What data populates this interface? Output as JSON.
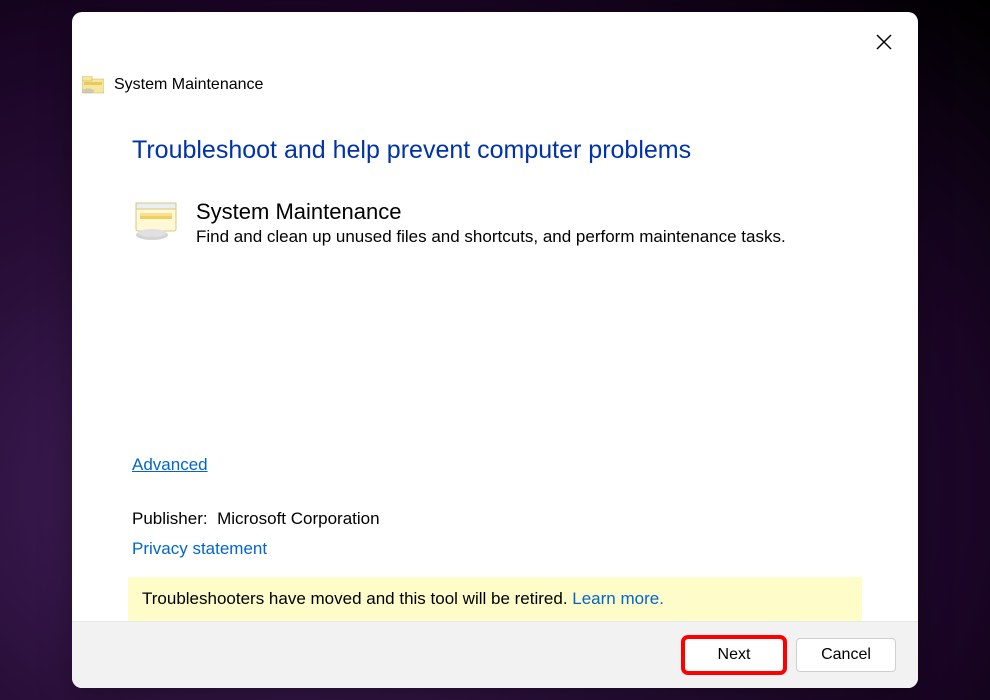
{
  "header": {
    "title": "System Maintenance"
  },
  "main": {
    "heading": "Troubleshoot and help prevent computer problems",
    "item_title": "System Maintenance",
    "item_desc": "Find and clean up unused files and shortcuts, and perform maintenance tasks."
  },
  "links": {
    "advanced": "Advanced",
    "privacy": "Privacy statement",
    "learn_more": "Learn more."
  },
  "publisher": {
    "label": "Publisher:",
    "value": "Microsoft Corporation"
  },
  "notice": {
    "text": "Troubleshooters have moved and this tool will be retired. "
  },
  "buttons": {
    "next": "Next",
    "cancel": "Cancel"
  }
}
